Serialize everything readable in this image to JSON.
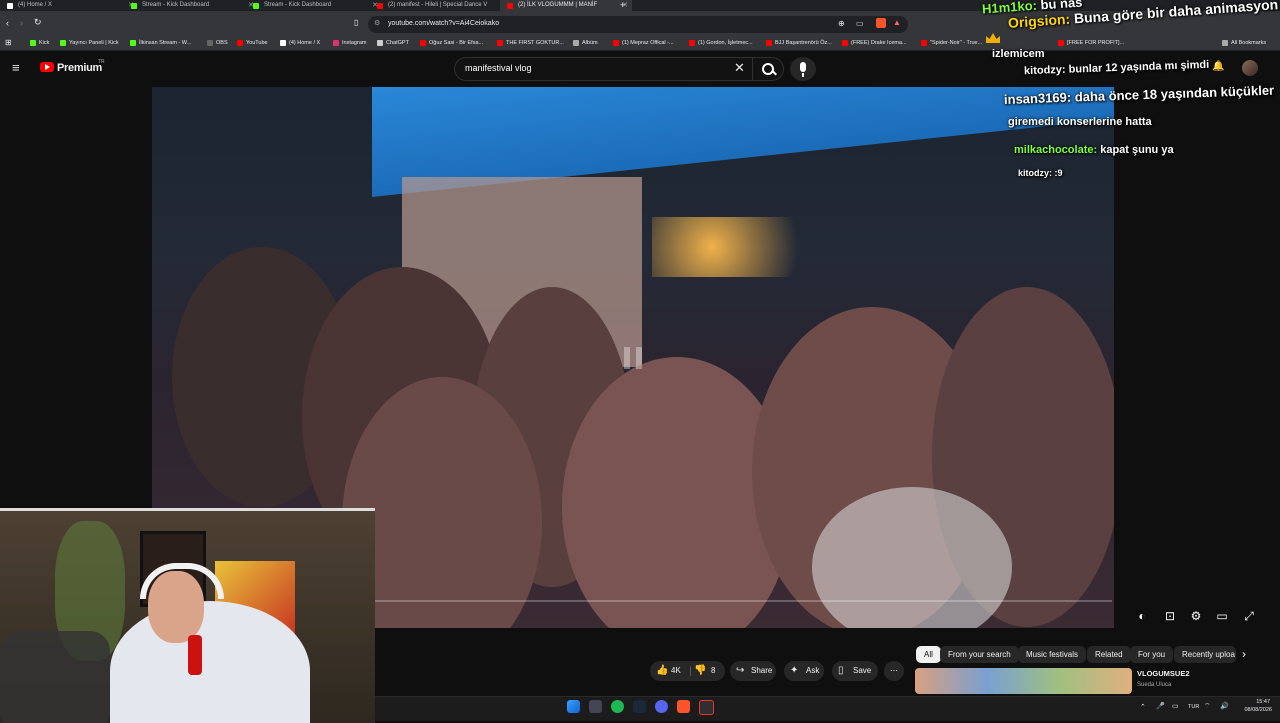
{
  "browser": {
    "tabs": [
      {
        "label": "(4) Home / X",
        "icon": "x-icon",
        "color": "#ffffff"
      },
      {
        "label": "Stream - Kick Dashboard",
        "icon": "kick-icon",
        "color": "#53fc18"
      },
      {
        "label": "Stream - Kick Dashboard",
        "icon": "kick-icon",
        "color": "#53fc18"
      },
      {
        "label": "(2) manifest - Hileli | Special Dance V",
        "icon": "youtube-icon",
        "color": "#ff0000"
      },
      {
        "label": "(2) İLK VLOGUMMM | MANİF",
        "icon": "youtube-icon",
        "color": "#ff0000"
      }
    ],
    "url": "youtube.com/watch?v=Ai4Ceiokako",
    "bookmarks": [
      {
        "label": "Kick",
        "color": "#53fc18"
      },
      {
        "label": "Yayıncı Paneli | Kick",
        "color": "#53fc18"
      },
      {
        "label": "İlkinsan Stream - W...",
        "color": "#53fc18"
      },
      {
        "label": "OBS",
        "color": "#666666"
      },
      {
        "label": "YouTube",
        "color": "#ff0000"
      },
      {
        "label": "(4) Home / X",
        "color": "#ffffff"
      },
      {
        "label": "Instagram",
        "color": "#e1306c"
      },
      {
        "label": "ChatGPT",
        "color": "#cccccc"
      },
      {
        "label": "Oğuz Sasi - Bir Efsa...",
        "color": "#ff0000"
      },
      {
        "label": "THE FIRST GOKTUR...",
        "color": "#ff0000"
      },
      {
        "label": "Albüm",
        "color": "#aaaaaa"
      },
      {
        "label": "(1) Mepraz Offical -...",
        "color": "#ff0000"
      },
      {
        "label": "(1) Gordon, İşletmec...",
        "color": "#ff0000"
      },
      {
        "label": "BJJ Başantrenörü Öz...",
        "color": "#ff0000"
      },
      {
        "label": "(FREE) Drake Icema...",
        "color": "#ff0000"
      },
      {
        "label": "\"Spider-Noir\" - True...",
        "color": "#ff0000"
      },
      {
        "label": "[FREE FOR PROFIT]...",
        "color": "#ff0000"
      }
    ],
    "all_bookmarks": "All Bookmarks"
  },
  "youtube": {
    "logo_text": "Premium",
    "logo_badge": "TR",
    "search_value": "manifestival vlog",
    "video": {
      "paused": true
    },
    "chips": [
      "All",
      "From your search",
      "Music festivals",
      "Related",
      "For you",
      "Recently uploa"
    ],
    "actions": {
      "likes": "4K",
      "dislikes": "8",
      "share": "Share",
      "ask": "Ask",
      "save": "Save"
    },
    "recommended": {
      "title": "VLOGUMSUE2",
      "channel": "Sueda Uluca"
    }
  },
  "chat": [
    {
      "user": "H1m1ko:",
      "text": "bu nas",
      "color": "#7fff3a"
    },
    {
      "user": "Origsion:",
      "text": "Buna göre bir daha animasyon",
      "color": "#ffd700"
    },
    {
      "user": "",
      "text": "izlemicem",
      "color": "#ffffff"
    },
    {
      "user": "kitodzy:",
      "text": "bunlar 12 yaşında mı şimdi",
      "color": "#ffffff"
    },
    {
      "user": "insan3169:",
      "text": "daha önce 18 yaşından küçükler",
      "color": "#ffffff"
    },
    {
      "user": "",
      "text": "giremedi konserlerine hatta",
      "color": "#ffffff"
    },
    {
      "user": "milkachocolate:",
      "text": "kapat şunu ya",
      "color": "#7fff3a"
    },
    {
      "user": "kitodzy:",
      "text": ":9",
      "color": "#ffffff"
    }
  ],
  "taskbar": {
    "lang": "TUR",
    "time": "15:47",
    "date": "08/08/2026"
  },
  "colors": {
    "accent": "#ff0000",
    "kick": "#53fc18",
    "background": "#0f0f0f"
  }
}
